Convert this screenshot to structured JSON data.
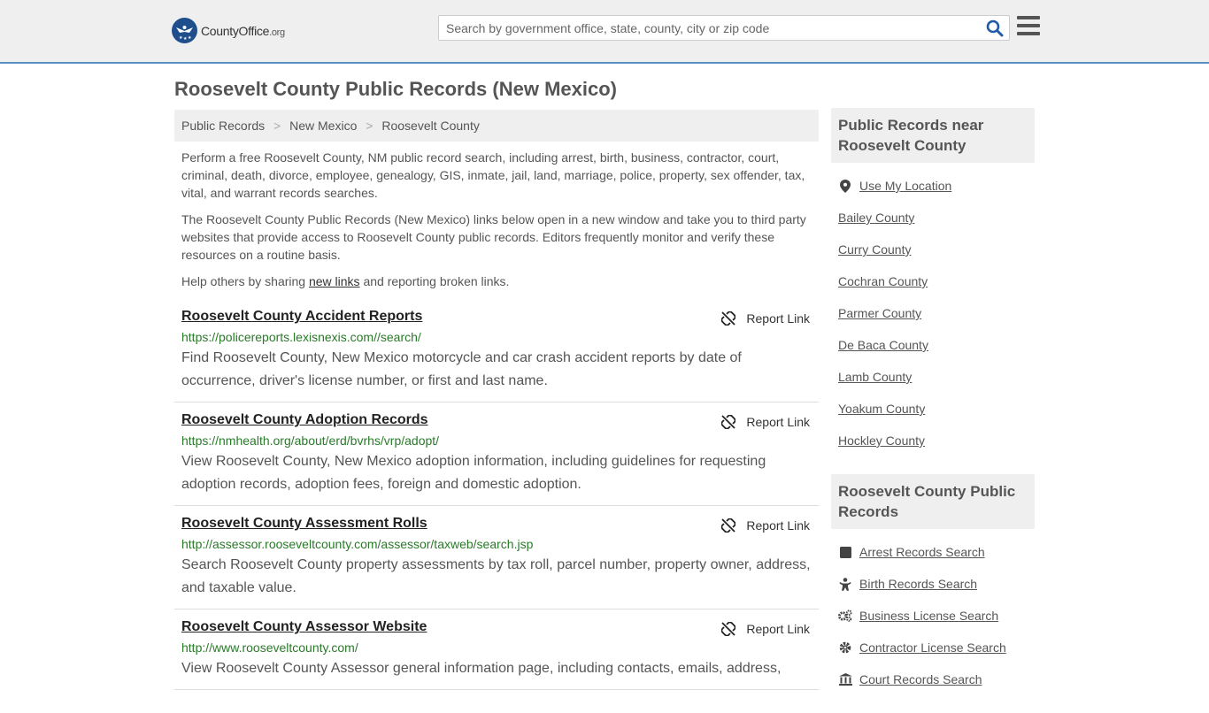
{
  "header": {
    "logo_text": "CountyOffice",
    "logo_suffix": ".org",
    "search_placeholder": "Search by government office, state, county, city or zip code",
    "search_value": ""
  },
  "page_title": "Roosevelt County Public Records (New Mexico)",
  "breadcrumb": [
    {
      "label": "Public Records"
    },
    {
      "label": "New Mexico"
    },
    {
      "label": "Roosevelt County"
    }
  ],
  "breadcrumb_separator": ">",
  "intro": {
    "p1": "Perform a free Roosevelt County, NM public record search, including arrest, birth, business, contractor, court, criminal, death, divorce, employee, genealogy, GIS, inmate, jail, land, marriage, police, property, sex offender, tax, vital, and warrant records searches.",
    "p2": "The Roosevelt County Public Records (New Mexico) links below open in a new window and take you to third party websites that provide access to Roosevelt County public records. Editors frequently monitor and verify these resources on a routine basis.",
    "p3_before": "Help others by sharing ",
    "p3_link": "new links",
    "p3_after": " and reporting broken links."
  },
  "records": [
    {
      "title": "Roosevelt County Accident Reports",
      "url": "https://policereports.lexisnexis.com//search/",
      "description": "Find Roosevelt County, New Mexico motorcycle and car crash accident reports by date of occurrence, driver's license number, or first and last name.",
      "report_label": "Report Link"
    },
    {
      "title": "Roosevelt County Adoption Records",
      "url": "https://nmhealth.org/about/erd/bvrhs/vrp/adopt/",
      "description": "View Roosevelt County, New Mexico adoption information, including guidelines for requesting adoption records, adoption fees, foreign and domestic adoption.",
      "report_label": "Report Link"
    },
    {
      "title": "Roosevelt County Assessment Rolls",
      "url": "http://assessor.rooseveltcounty.com/assessor/taxweb/search.jsp",
      "description": "Search Roosevelt County property assessments by tax roll, parcel number, property owner, address, and taxable value.",
      "report_label": "Report Link"
    },
    {
      "title": "Roosevelt County Assessor Website",
      "url": "http://www.rooseveltcounty.com/",
      "description": "View Roosevelt County Assessor general information page, including contacts, emails, address,",
      "report_label": "Report Link"
    }
  ],
  "sidebar": {
    "nearby": {
      "heading": "Public Records near Roosevelt County",
      "use_location": "Use My Location",
      "items": [
        "Bailey County",
        "Curry County",
        "Cochran County",
        "Parmer County",
        "De Baca County",
        "Lamb County",
        "Yoakum County",
        "Hockley County"
      ]
    },
    "county_records": {
      "heading": "Roosevelt County Public Records",
      "items": [
        {
          "label": "Arrest Records Search",
          "icon": "square-icon"
        },
        {
          "label": "Birth Records Search",
          "icon": "baby-icon"
        },
        {
          "label": "Business License Search",
          "icon": "gears-icon"
        },
        {
          "label": "Contractor License Search",
          "icon": "gear-icon"
        },
        {
          "label": "Court Records Search",
          "icon": "courthouse-icon"
        }
      ]
    }
  },
  "colors": {
    "header_bg": "#efefef",
    "header_border": "#5b8fc4",
    "logo_blue": "#1f4e8c",
    "search_icon": "#1f5ba8",
    "url_green": "#2a7a2a"
  }
}
